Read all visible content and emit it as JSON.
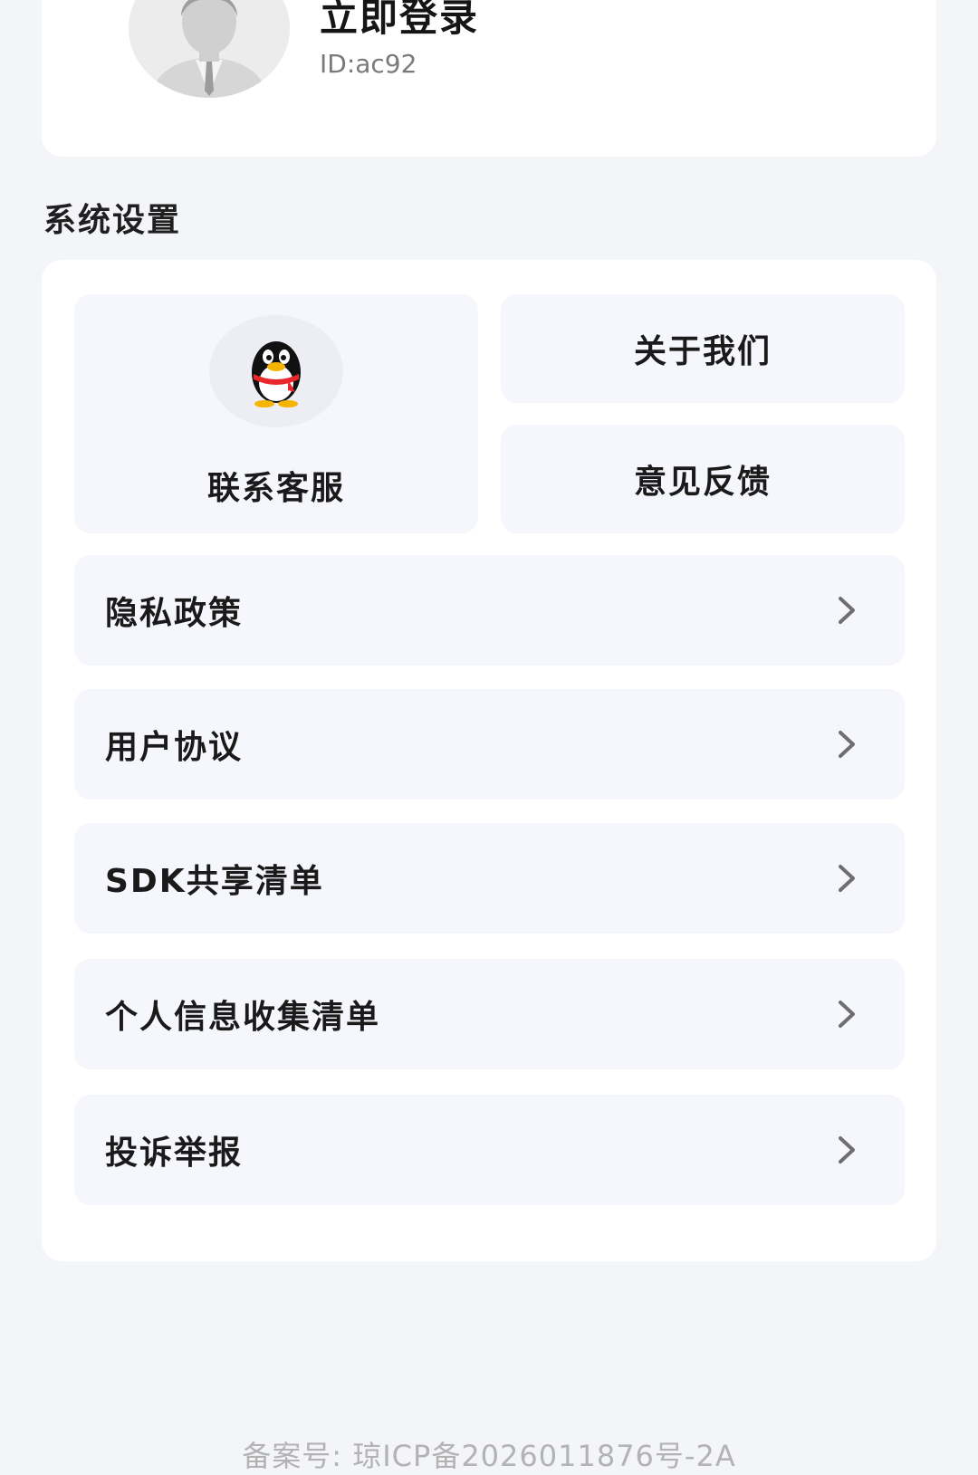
{
  "profile": {
    "login_label": "立即登录",
    "user_id": "ID:ac92",
    "avatar_icon": "user-avatar-icon"
  },
  "settings": {
    "section_title": "系统设置",
    "contact_service": {
      "label": "联系客服",
      "icon": "qq-penguin-icon"
    },
    "about_us": {
      "label": "关于我们"
    },
    "feedback": {
      "label": "意见反馈"
    },
    "items": [
      {
        "label": "隐私政策",
        "icon": "chevron-right-icon"
      },
      {
        "label": "用户协议",
        "icon": "chevron-right-icon"
      },
      {
        "label": "SDK共享清单",
        "icon": "chevron-right-icon"
      },
      {
        "label": "个人信息收集清单",
        "icon": "chevron-right-icon"
      },
      {
        "label": "投诉举报",
        "icon": "chevron-right-icon"
      }
    ]
  },
  "footer": {
    "icp": "备案号: 琼ICP备2026011876号-2A"
  },
  "colors": {
    "page_background": "#f4f5f9",
    "card_background": "#ffffff",
    "tile_background": "#f5f7fc",
    "qq_scarf_red": "#e8262b",
    "qq_beak_yellow": "#f5b400"
  }
}
